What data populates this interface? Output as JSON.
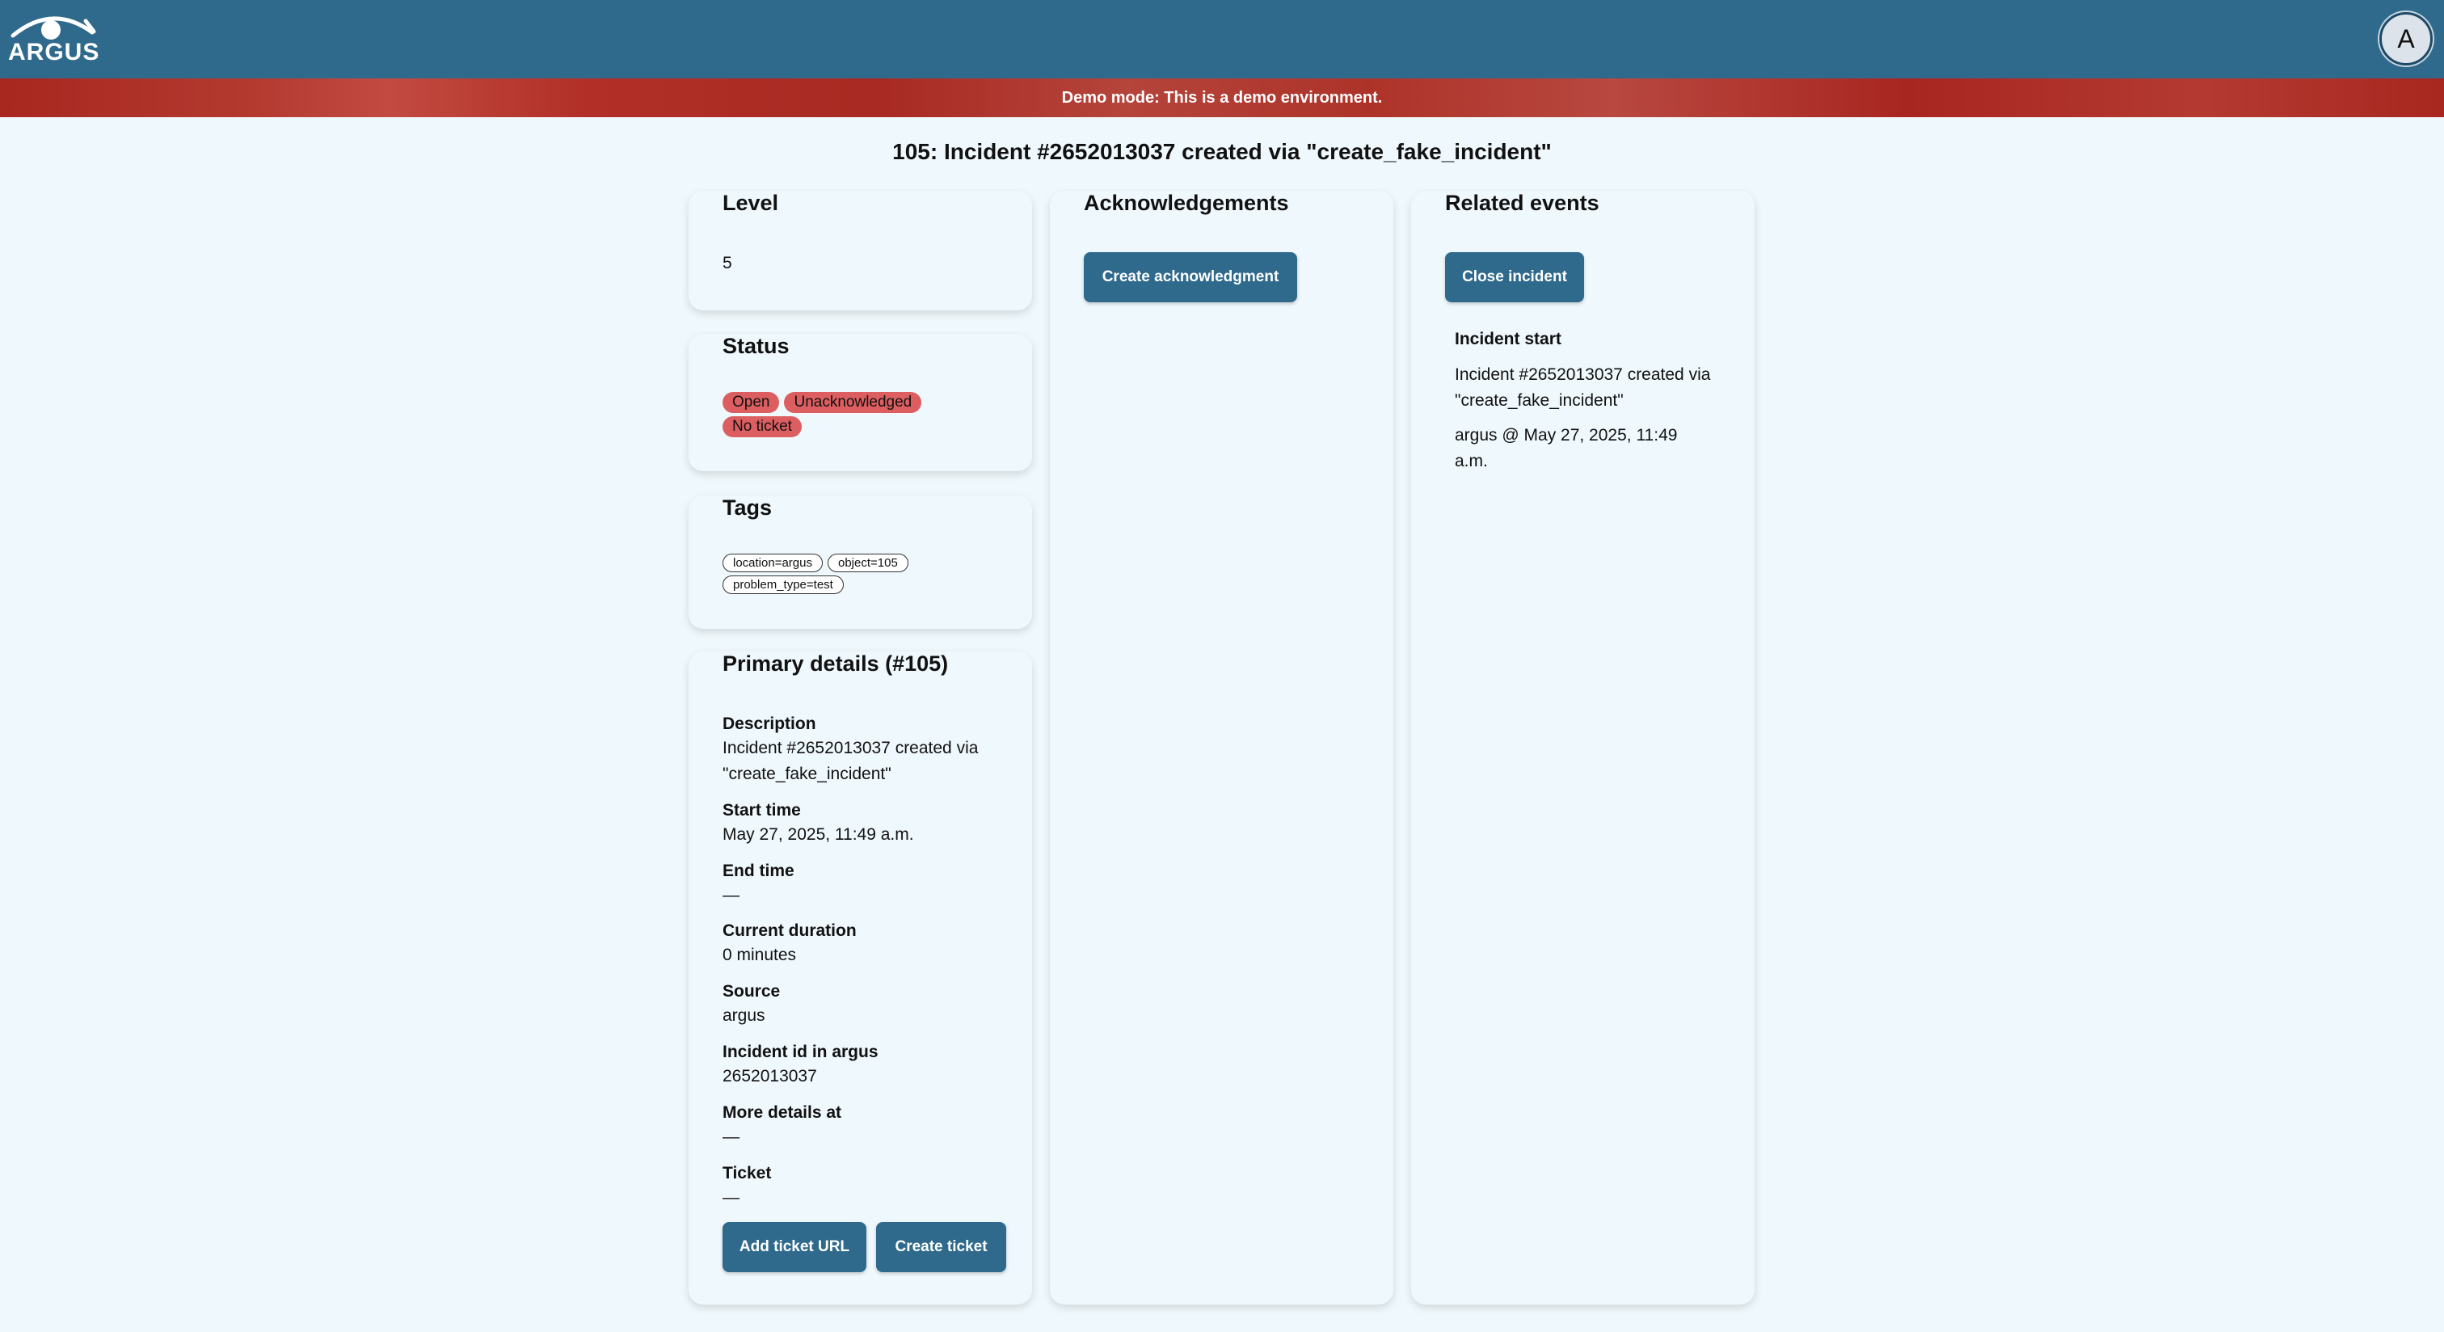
{
  "header": {
    "logo_text": "ARGUS",
    "avatar_initial": "A"
  },
  "banner": {
    "text": "Demo mode: This is a demo environment."
  },
  "page": {
    "title": "105: Incident #2652013037 created via \"create_fake_incident\""
  },
  "level": {
    "heading": "Level",
    "value": "5"
  },
  "status": {
    "heading": "Status",
    "badges": [
      "Open",
      "Unacknowledged",
      "No ticket"
    ]
  },
  "tags": {
    "heading": "Tags",
    "items": [
      "location=argus",
      "object=105",
      "problem_type=test"
    ]
  },
  "primary": {
    "heading": "Primary details (#105)",
    "fields": [
      {
        "label": "Description",
        "value": "Incident #2652013037 created via \"create_fake_incident\""
      },
      {
        "label": "Start time",
        "value": "May 27, 2025, 11:49 a.m."
      },
      {
        "label": "End time",
        "value": "—"
      },
      {
        "label": "Current duration",
        "value": "0 minutes"
      },
      {
        "label": "Source",
        "value": "argus"
      },
      {
        "label": "Incident id in argus",
        "value": "2652013037"
      },
      {
        "label": "More details at",
        "value": "—"
      },
      {
        "label": "Ticket",
        "value": "—"
      }
    ],
    "add_ticket_url_label": "Add ticket URL",
    "create_ticket_label": "Create ticket"
  },
  "acknowledgements": {
    "heading": "Acknowledgements",
    "create_label": "Create acknowledgment"
  },
  "related": {
    "heading": "Related events",
    "close_label": "Close incident",
    "events": [
      {
        "title": "Incident start",
        "description": "Incident #2652013037 created via \"create_fake_incident\"",
        "meta": "argus @ May 27, 2025, 11:49 a.m."
      }
    ]
  },
  "colors": {
    "header_bg": "#2f6a8d",
    "banner_bg": "#a8271f",
    "page_bg": "#eff8fc",
    "badge_bg": "#dd5e60",
    "button_bg": "#2f6a8d"
  },
  "icons": {
    "logo": "eye-logo-icon"
  }
}
